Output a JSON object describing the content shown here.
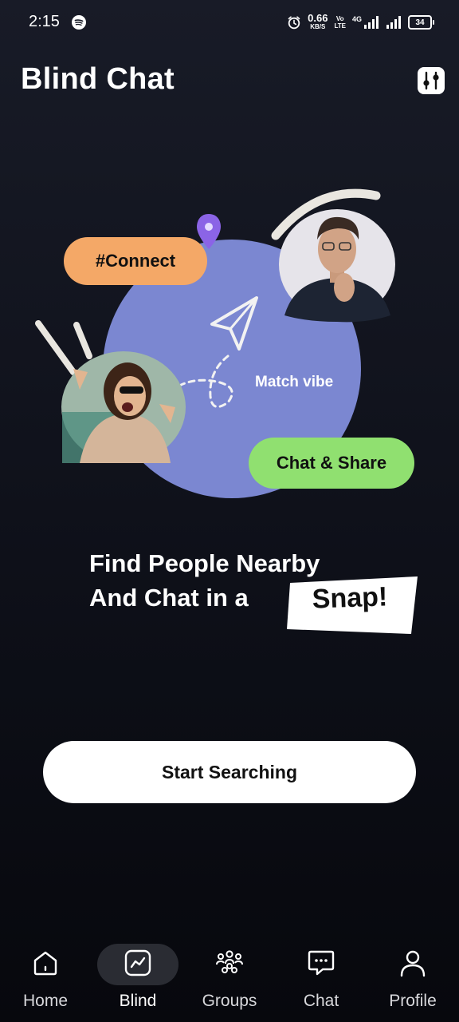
{
  "status_bar": {
    "time": "2:15",
    "speed_value": "0.66",
    "speed_unit": "KB/S",
    "volte_top": "Vo",
    "volte_bottom": "LTE",
    "network": "4G",
    "battery": "34"
  },
  "header": {
    "title": "Blind Chat"
  },
  "hero": {
    "tag_connect": "#Connect",
    "tag_match": "Match vibe",
    "tag_chat_share": "Chat & Share",
    "colors": {
      "circle": "#7b87d1",
      "connect_pill": "#f4a867",
      "chat_pill": "#90e070",
      "pin": "#8b64e6"
    }
  },
  "headline": {
    "line1": "Find People Nearby",
    "line2": "And Chat in a",
    "highlight": "Snap!"
  },
  "actions": {
    "start_label": "Start Searching"
  },
  "nav": {
    "items": [
      {
        "label": "Home",
        "icon": "home-icon"
      },
      {
        "label": "Blind",
        "icon": "blind-chart-icon"
      },
      {
        "label": "Groups",
        "icon": "groups-icon"
      },
      {
        "label": "Chat",
        "icon": "chat-icon"
      },
      {
        "label": "Profile",
        "icon": "profile-icon"
      }
    ],
    "active": "Blind"
  }
}
